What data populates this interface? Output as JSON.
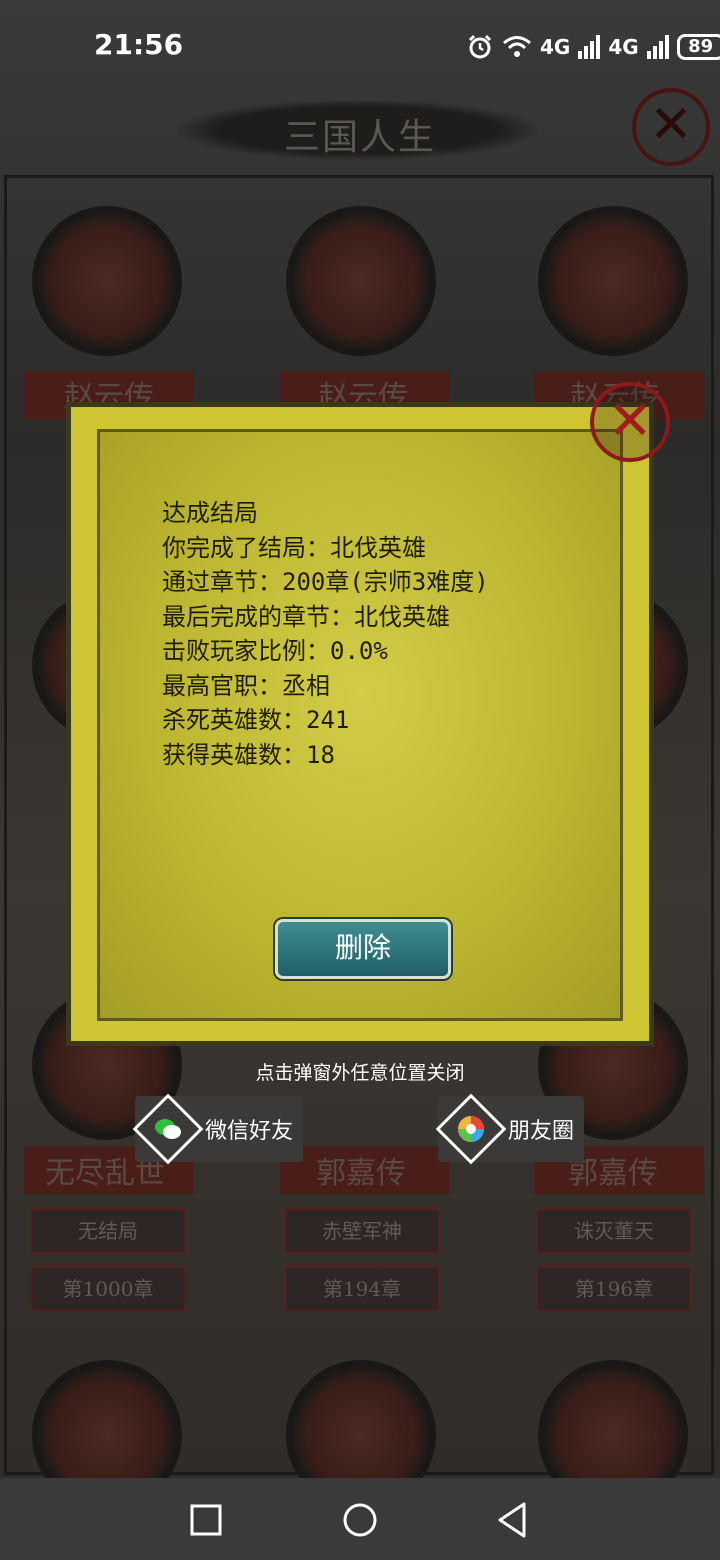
{
  "status_bar": {
    "time": "21:56",
    "signal_1": "4G",
    "signal_2": "4G",
    "battery": "89"
  },
  "page": {
    "title": "三国人生"
  },
  "background_cards": {
    "row1_banners": [
      "赵云传",
      "赵云传",
      "赵云传"
    ],
    "row3_banners": [
      "无尽乱世",
      "郭嘉传",
      "郭嘉传"
    ],
    "row3_endings": [
      "无结局",
      "赤壁军神",
      "诛灭董天"
    ],
    "row3_chapters": [
      "第1000章",
      "第194章",
      "第196章"
    ]
  },
  "dialog": {
    "lines": [
      "达成结局",
      "你完成了结局：北伐英雄",
      "通过章节：200章(宗师3难度)",
      "最后完成的章节：北伐英雄",
      "击败玩家比例：0.0%",
      "最高官职：丞相",
      "杀死英雄数：241",
      "获得英雄数：18"
    ],
    "delete_label": "删除"
  },
  "hint": "点击弹窗外任意位置关闭",
  "share": {
    "wechat_friend": "微信好友",
    "moments": "朋友圈"
  },
  "colors": {
    "dialog_paper": "#cfc532",
    "delete_button": "#2f7a80",
    "close_red": "#9e1c1c"
  }
}
